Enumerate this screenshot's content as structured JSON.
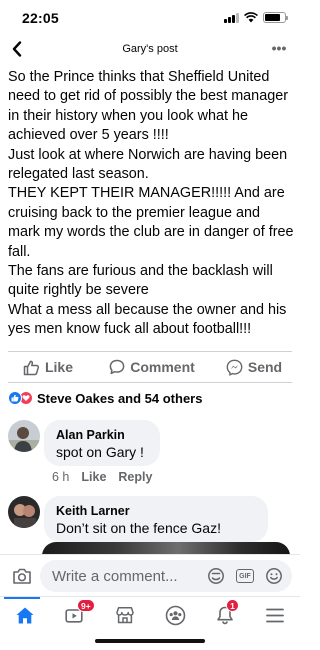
{
  "status_bar": {
    "time": "22:05"
  },
  "header": {
    "title": "Gary's post",
    "more_label": "•••"
  },
  "post": {
    "paragraphs": [
      "So the Prince thinks that Sheffield United need to get rid of possibly the best manager in their history when you look what he achieved over 5 years !!!!",
      "Just look at where Norwich are having been relegated last season.",
      "THEY KEPT THEIR MANAGER!!!!! And are cruising back to the premier league and mark my words the club are in danger of free fall.",
      "The fans are furious and the backlash will quite rightly be severe",
      "What a mess all because the owner and his yes men know fuck all about football!!!"
    ]
  },
  "actions": {
    "like": "Like",
    "comment": "Comment",
    "send": "Send"
  },
  "reactions": {
    "summary": "Steve Oakes and 54 others"
  },
  "comments": [
    {
      "author": "Alan Parkin",
      "text": "spot on Gary !",
      "time": "6 h",
      "like": "Like",
      "reply": "Reply"
    },
    {
      "author": "Keith Larner",
      "text": "Don’t sit on the fence Gaz!"
    }
  ],
  "composer": {
    "placeholder": "Write a comment...",
    "gif_label": "GIF"
  },
  "tabbar": {
    "badges": {
      "watch": "9+",
      "notifications": "1"
    }
  },
  "colors": {
    "accent": "#1877f2",
    "badge": "#e41e3f",
    "love": "#f33e58",
    "bubble": "#f0f2f5"
  }
}
